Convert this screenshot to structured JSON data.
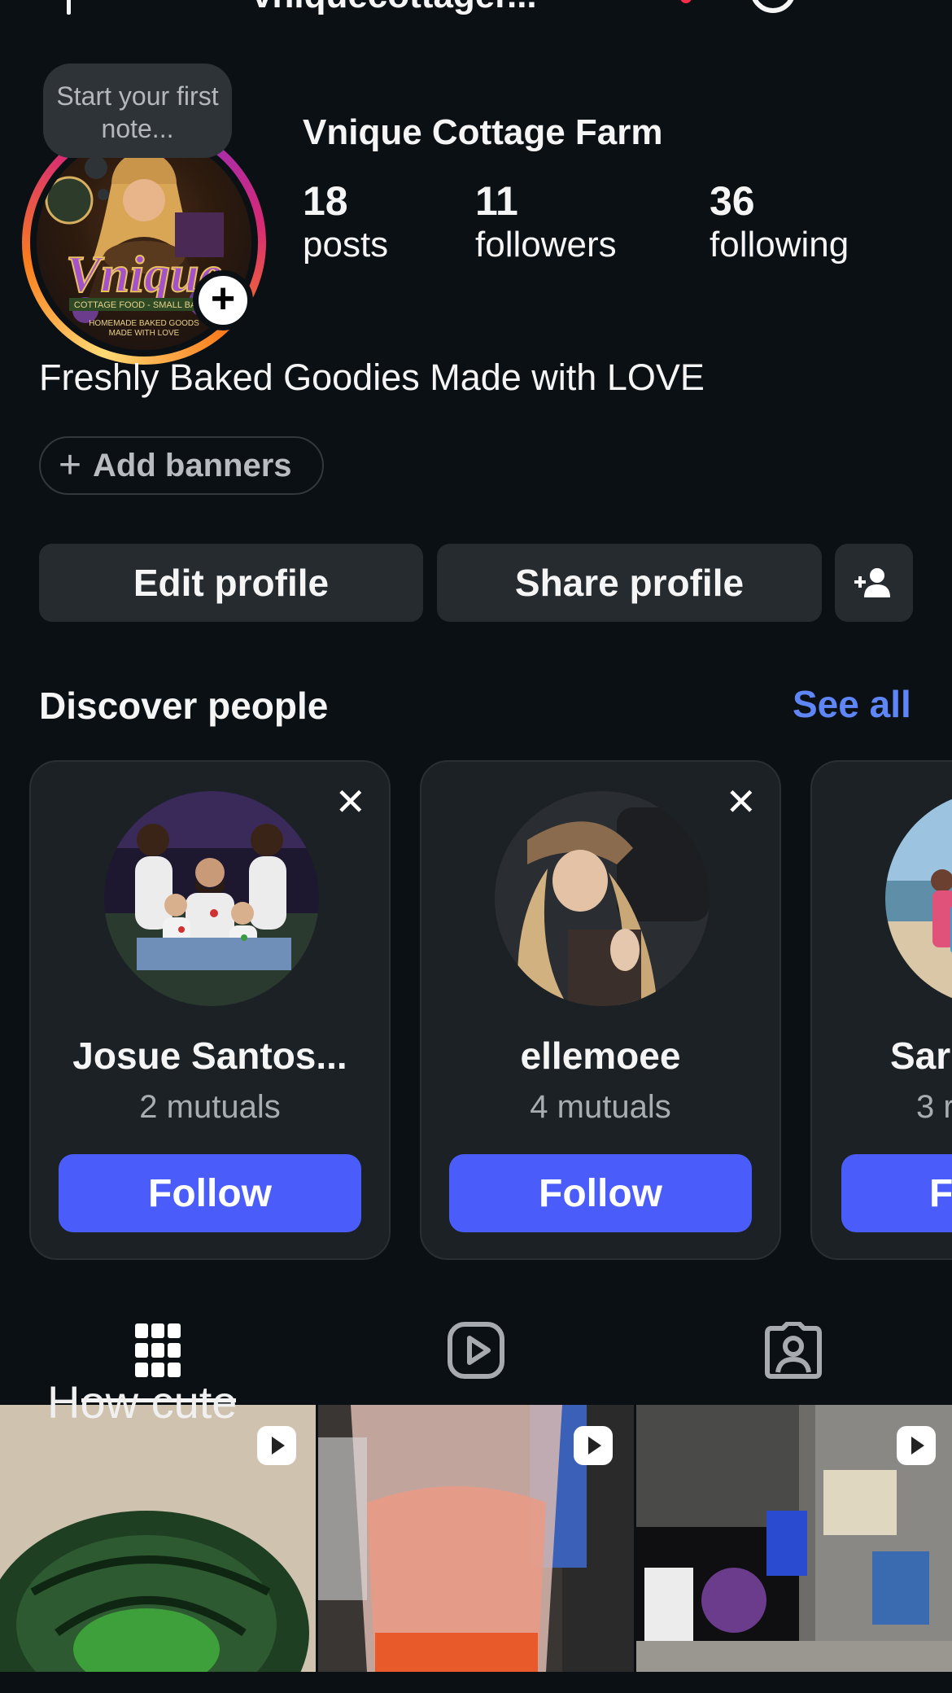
{
  "header": {
    "username": "vniquecottager...",
    "icons": [
      "back-arrow-icon",
      "threads-icon",
      "menu-icon"
    ],
    "notification_color": "#ff2b48"
  },
  "profile": {
    "note_placeholder": "Start your first note...",
    "display_name": "Vnique Cottage Farm",
    "stats": [
      {
        "value": "18",
        "label": "posts"
      },
      {
        "value": "11",
        "label": "followers"
      },
      {
        "value": "36",
        "label": "following"
      }
    ],
    "bio": "Freshly Baked Goodies Made with LOVE",
    "add_banners_label": "Add banners",
    "avatar_logo_text": "Vnique",
    "avatar_sub_text": "COTTAGE FOOD - SMALL BATCH",
    "avatar_sub_text2": "HOMEMADE BAKED GOODS MADE WITH LOVE"
  },
  "actions": {
    "edit_profile": "Edit profile",
    "share_profile": "Share profile"
  },
  "discover": {
    "title": "Discover people",
    "see_all": "See all",
    "cards": [
      {
        "name": "Josue Santos...",
        "mutuals": "2 mutuals",
        "follow": "Follow"
      },
      {
        "name": "ellemoee",
        "mutuals": "4 mutuals",
        "follow": "Follow"
      },
      {
        "name": "Sar",
        "mutuals": "3 r",
        "follow": "F"
      }
    ]
  },
  "tabs": [
    "grid-icon",
    "reels-icon",
    "tagged-icon"
  ],
  "grid": {
    "caption_overlay": "How cute",
    "posts": [
      {
        "type": "reel"
      },
      {
        "type": "reel"
      },
      {
        "type": "reel"
      }
    ]
  },
  "colors": {
    "background": "#0b1014",
    "button": "#262b30",
    "follow": "#4a5dfa",
    "link": "#5f86f7"
  }
}
